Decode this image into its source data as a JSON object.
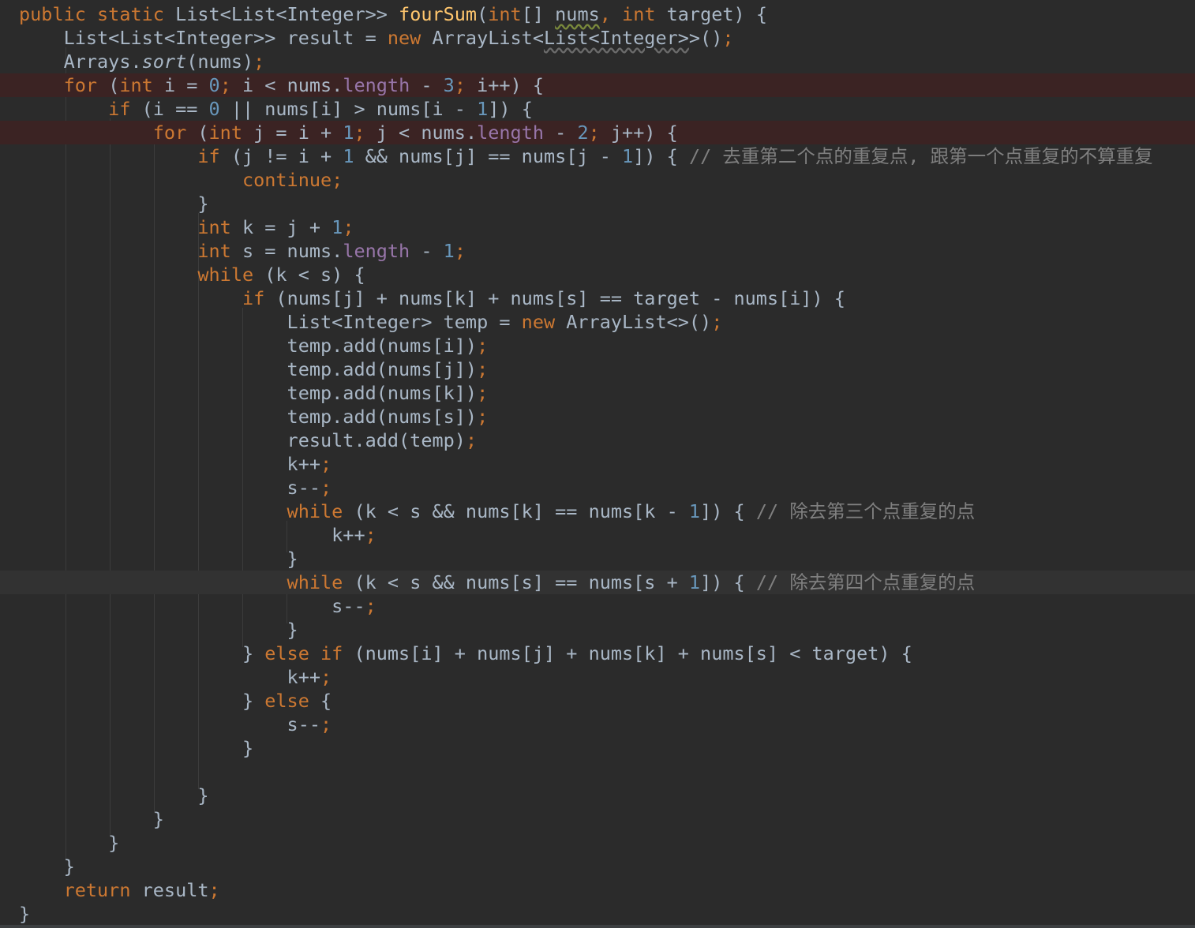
{
  "editor": {
    "theme_colors": {
      "background": "#2b2b2b",
      "keyword": "#cc7832",
      "function": "#ffc66d",
      "number": "#6897bb",
      "field": "#9876aa",
      "comment": "#808080",
      "text": "#a9b7c6",
      "breakpoint_line": "#3b2323"
    },
    "lines": [
      [
        [
          "kw",
          "public static "
        ],
        [
          "txt",
          "List<List<Integer>> "
        ],
        [
          "fn",
          "fourSum"
        ],
        [
          "txt",
          "("
        ],
        [
          "kw",
          "int"
        ],
        [
          "txt",
          "[] "
        ],
        [
          "squig",
          "nums"
        ],
        [
          "kw",
          ", int "
        ],
        [
          "txt",
          "target) {"
        ]
      ],
      [
        [
          "txt",
          "    List<List<Integer>> result = "
        ],
        [
          "kw",
          "new "
        ],
        [
          "txt",
          "ArrayList<"
        ],
        [
          "squigray",
          "List<Integer>"
        ],
        [
          "txt",
          ">()"
        ],
        [
          "kw",
          ";"
        ]
      ],
      [
        [
          "txt",
          "    Arrays."
        ],
        [
          "it",
          "sort"
        ],
        [
          "txt",
          "(nums)"
        ],
        [
          "kw",
          ";"
        ]
      ],
      [
        [
          "kw",
          "    for "
        ],
        [
          "txt",
          "("
        ],
        [
          "kw",
          "int "
        ],
        [
          "txt",
          "i = "
        ],
        [
          "num",
          "0"
        ],
        [
          "kw",
          "; "
        ],
        [
          "txt",
          "i < nums."
        ],
        [
          "fld",
          "length "
        ],
        [
          "txt",
          "- "
        ],
        [
          "num",
          "3"
        ],
        [
          "kw",
          "; "
        ],
        [
          "txt",
          "i++) {"
        ]
      ],
      [
        [
          "kw",
          "        if "
        ],
        [
          "txt",
          "(i == "
        ],
        [
          "num",
          "0 "
        ],
        [
          "txt",
          "|| nums[i] > nums[i - "
        ],
        [
          "num",
          "1"
        ],
        [
          "txt",
          "]) {"
        ]
      ],
      [
        [
          "kw",
          "            for "
        ],
        [
          "txt",
          "("
        ],
        [
          "kw",
          "int "
        ],
        [
          "txt",
          "j = i + "
        ],
        [
          "num",
          "1"
        ],
        [
          "kw",
          "; "
        ],
        [
          "txt",
          "j < nums."
        ],
        [
          "fld",
          "length "
        ],
        [
          "txt",
          "- "
        ],
        [
          "num",
          "2"
        ],
        [
          "kw",
          "; "
        ],
        [
          "txt",
          "j++) {"
        ]
      ],
      [
        [
          "kw",
          "                if "
        ],
        [
          "txt",
          "(j != i + "
        ],
        [
          "num",
          "1 "
        ],
        [
          "txt",
          "&& nums[j] == nums[j - "
        ],
        [
          "num",
          "1"
        ],
        [
          "txt",
          "]) { "
        ],
        [
          "cmt",
          "// 去重第二个点的重复点, 跟第一个点重复的不算重复"
        ]
      ],
      [
        [
          "kw",
          "                    continue;"
        ]
      ],
      [
        [
          "txt",
          "                }"
        ]
      ],
      [
        [
          "kw",
          "                int "
        ],
        [
          "txt",
          "k = j + "
        ],
        [
          "num",
          "1"
        ],
        [
          "kw",
          ";"
        ]
      ],
      [
        [
          "kw",
          "                int "
        ],
        [
          "txt",
          "s = nums."
        ],
        [
          "fld",
          "length "
        ],
        [
          "txt",
          "- "
        ],
        [
          "num",
          "1"
        ],
        [
          "kw",
          ";"
        ]
      ],
      [
        [
          "kw",
          "                while "
        ],
        [
          "txt",
          "(k < s) {"
        ]
      ],
      [
        [
          "kw",
          "                    if "
        ],
        [
          "txt",
          "(nums[j] + nums[k] + nums[s] == target - nums[i]) {"
        ]
      ],
      [
        [
          "txt",
          "                        List<Integer> temp = "
        ],
        [
          "kw",
          "new "
        ],
        [
          "txt",
          "ArrayList<>()"
        ],
        [
          "kw",
          ";"
        ]
      ],
      [
        [
          "txt",
          "                        temp.add(nums[i])"
        ],
        [
          "kw",
          ";"
        ]
      ],
      [
        [
          "txt",
          "                        temp.add(nums[j])"
        ],
        [
          "kw",
          ";"
        ]
      ],
      [
        [
          "txt",
          "                        temp.add(nums[k])"
        ],
        [
          "kw",
          ";"
        ]
      ],
      [
        [
          "txt",
          "                        temp.add(nums[s])"
        ],
        [
          "kw",
          ";"
        ]
      ],
      [
        [
          "txt",
          "                        result.add(temp)"
        ],
        [
          "kw",
          ";"
        ]
      ],
      [
        [
          "txt",
          "                        k++"
        ],
        [
          "kw",
          ";"
        ]
      ],
      [
        [
          "txt",
          "                        s--"
        ],
        [
          "kw",
          ";"
        ]
      ],
      [
        [
          "kw",
          "                        while "
        ],
        [
          "txt",
          "(k < s && nums[k] == nums[k - "
        ],
        [
          "num",
          "1"
        ],
        [
          "txt",
          "]) { "
        ],
        [
          "cmt",
          "// 除去第三个点重复的点"
        ]
      ],
      [
        [
          "txt",
          "                            k++"
        ],
        [
          "kw",
          ";"
        ]
      ],
      [
        [
          "txt",
          "                        }"
        ]
      ],
      [
        [
          "kw",
          "                        while "
        ],
        [
          "txt",
          "(k < s && nums[s] == nums[s + "
        ],
        [
          "num",
          "1"
        ],
        [
          "txt",
          "]) { "
        ],
        [
          "cmt",
          "// 除去第四个点重复的点"
        ]
      ],
      [
        [
          "txt",
          "                            s--"
        ],
        [
          "kw",
          ";"
        ]
      ],
      [
        [
          "txt",
          "                        }"
        ]
      ],
      [
        [
          "txt",
          "                    } "
        ],
        [
          "kw",
          "else if "
        ],
        [
          "txt",
          "(nums[i] + nums[j] + nums[k] + nums[s] < target) {"
        ]
      ],
      [
        [
          "txt",
          "                        k++"
        ],
        [
          "kw",
          ";"
        ]
      ],
      [
        [
          "txt",
          "                    } "
        ],
        [
          "kw",
          "else "
        ],
        [
          "txt",
          "{"
        ]
      ],
      [
        [
          "txt",
          "                        s--"
        ],
        [
          "kw",
          ";"
        ]
      ],
      [
        [
          "txt",
          "                    }"
        ]
      ],
      [
        [
          "txt",
          ""
        ]
      ],
      [
        [
          "txt",
          "                }"
        ]
      ],
      [
        [
          "txt",
          "            }"
        ]
      ],
      [
        [
          "txt",
          "        }"
        ]
      ],
      [
        [
          "txt",
          "    }"
        ]
      ],
      [
        [
          "kw",
          "    return "
        ],
        [
          "txt",
          "result"
        ],
        [
          "kw",
          ";"
        ]
      ],
      [
        [
          "txt",
          "}"
        ]
      ]
    ]
  }
}
